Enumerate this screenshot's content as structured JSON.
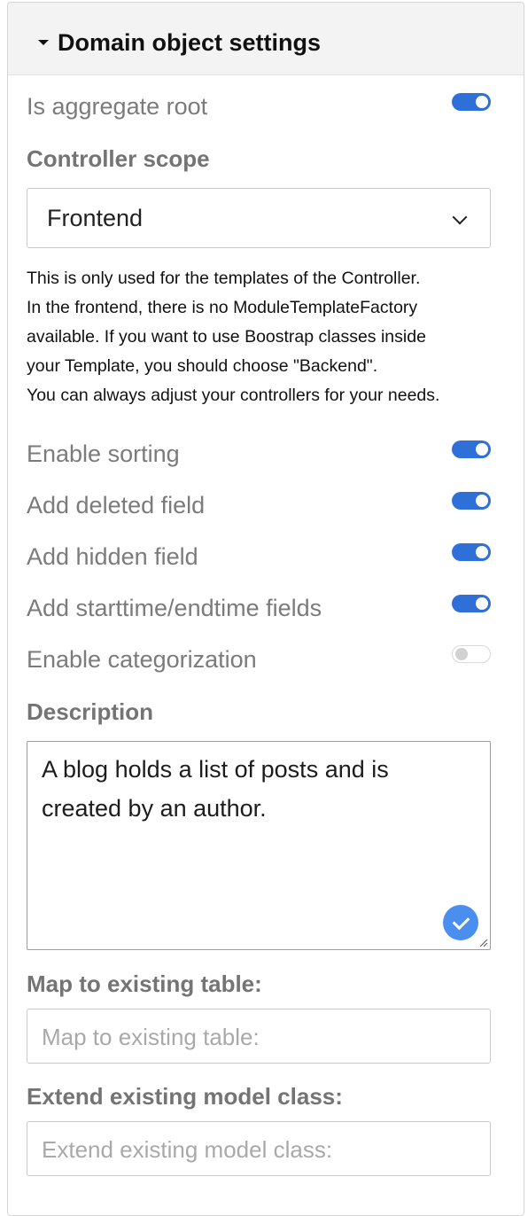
{
  "panel": {
    "title": "Domain object settings"
  },
  "aggregate_root": {
    "label": "Is aggregate root",
    "enabled": true
  },
  "controller_scope": {
    "label": "Controller scope",
    "selected": "Frontend",
    "help_lines": [
      "This is only used for the templates of the Controller.",
      "In the frontend, there is no ModuleTemplateFactory",
      "available. If you want to use Boostrap classes inside",
      "your Template, you should choose \"Backend\".",
      "You can always adjust your controllers for your needs."
    ]
  },
  "toggles": [
    {
      "label": "Enable sorting",
      "enabled": true
    },
    {
      "label": "Add deleted field",
      "enabled": true
    },
    {
      "label": "Add hidden field",
      "enabled": true
    },
    {
      "label": "Add starttime/endtime fields",
      "enabled": true
    },
    {
      "label": "Enable categorization",
      "enabled": false
    }
  ],
  "description": {
    "label": "Description",
    "value_lines": [
      "A blog holds a list of posts and is",
      "created by an author."
    ]
  },
  "map_table": {
    "label": "Map to existing table:",
    "placeholder": "Map to existing table:"
  },
  "extend_class": {
    "label": "Extend existing model class:",
    "placeholder": "Extend existing model class:"
  },
  "colors": {
    "toggle_on": "#2f6fd8",
    "check_badge": "#4a8ef0",
    "header_bg": "#f3f3f3"
  }
}
